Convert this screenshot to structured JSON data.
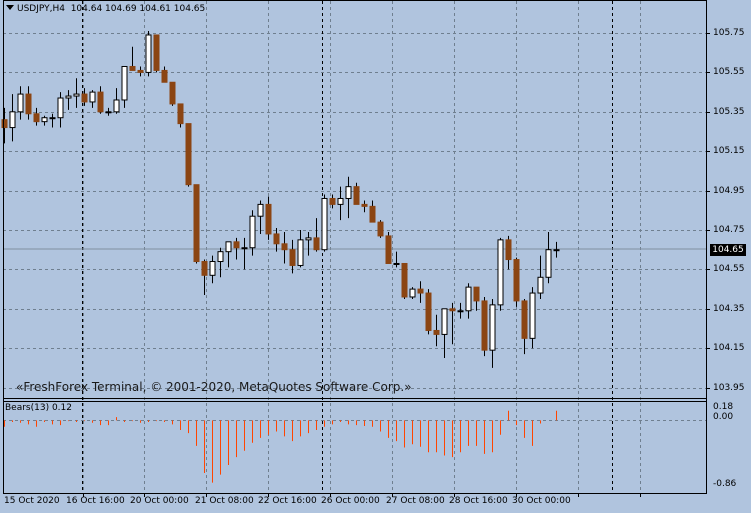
{
  "header": {
    "symbol_tf": "USDJPY,H4",
    "ohlc": "104.64 104.69 104.61 104.65"
  },
  "copyright": "«FreshForex Terminal, © 2001-2020, MetaQuotes Software Corp.»",
  "price_axis": {
    "ticks": [
      "105.75",
      "105.55",
      "105.35",
      "105.15",
      "104.95",
      "104.75",
      "104.55",
      "104.35",
      "104.15",
      "103.95"
    ],
    "current_price": "104.65"
  },
  "time_axis": {
    "ticks": [
      "15 Oct 2020",
      "16 Oct 16:00",
      "20 Oct 00:00",
      "21 Oct 08:00",
      "22 Oct 16:00",
      "26 Oct 00:00",
      "27 Oct 08:00",
      "28 Oct 16:00",
      "30 Oct 00:00"
    ]
  },
  "indicator": {
    "title": "Bears(13) 0.12",
    "ticks": [
      "0.18",
      "0.00",
      "-0.86"
    ]
  },
  "colors": {
    "background": "#b0c4de",
    "bull": "#ffffff",
    "bear": "#8b4513",
    "histogram": "#ff4500",
    "grid": "#6f7f8f"
  },
  "chart_data": {
    "type": "candlestick",
    "ylim": [
      103.91,
      105.82
    ],
    "candles": [
      {
        "o": 105.31,
        "h": 105.37,
        "l": 105.19,
        "c": 105.27
      },
      {
        "o": 105.27,
        "h": 105.44,
        "l": 105.2,
        "c": 105.35
      },
      {
        "o": 105.35,
        "h": 105.48,
        "l": 105.31,
        "c": 105.44
      },
      {
        "o": 105.44,
        "h": 105.48,
        "l": 105.31,
        "c": 105.34
      },
      {
        "o": 105.34,
        "h": 105.37,
        "l": 105.28,
        "c": 105.3
      },
      {
        "o": 105.3,
        "h": 105.33,
        "l": 105.28,
        "c": 105.32
      },
      {
        "o": 105.32,
        "h": 105.34,
        "l": 105.27,
        "c": 105.32
      },
      {
        "o": 105.32,
        "h": 105.45,
        "l": 105.27,
        "c": 105.42
      },
      {
        "o": 105.42,
        "h": 105.46,
        "l": 105.36,
        "c": 105.43
      },
      {
        "o": 105.43,
        "h": 105.52,
        "l": 105.37,
        "c": 105.44
      },
      {
        "o": 105.44,
        "h": 105.47,
        "l": 105.38,
        "c": 105.4
      },
      {
        "o": 105.4,
        "h": 105.46,
        "l": 105.37,
        "c": 105.45
      },
      {
        "o": 105.45,
        "h": 105.48,
        "l": 105.34,
        "c": 105.35
      },
      {
        "o": 105.35,
        "h": 105.37,
        "l": 105.33,
        "c": 105.35
      },
      {
        "o": 105.35,
        "h": 105.47,
        "l": 105.34,
        "c": 105.41
      },
      {
        "o": 105.41,
        "h": 105.57,
        "l": 105.37,
        "c": 105.58
      },
      {
        "o": 105.58,
        "h": 105.68,
        "l": 105.56,
        "c": 105.56
      },
      {
        "o": 105.56,
        "h": 105.58,
        "l": 105.53,
        "c": 105.55
      },
      {
        "o": 105.55,
        "h": 105.76,
        "l": 105.53,
        "c": 105.74
      },
      {
        "o": 105.74,
        "h": 105.69,
        "l": 105.55,
        "c": 105.56
      },
      {
        "o": 105.56,
        "h": 105.58,
        "l": 105.5,
        "c": 105.5
      },
      {
        "o": 105.5,
        "h": 105.5,
        "l": 105.38,
        "c": 105.39
      },
      {
        "o": 105.39,
        "h": 105.39,
        "l": 105.27,
        "c": 105.29
      },
      {
        "o": 105.29,
        "h": 105.29,
        "l": 104.97,
        "c": 104.98
      },
      {
        "o": 104.98,
        "h": 104.98,
        "l": 104.58,
        "c": 104.59
      },
      {
        "o": 104.59,
        "h": 104.6,
        "l": 104.42,
        "c": 104.52
      },
      {
        "o": 104.52,
        "h": 104.62,
        "l": 104.48,
        "c": 104.59
      },
      {
        "o": 104.59,
        "h": 104.66,
        "l": 104.51,
        "c": 104.64
      },
      {
        "o": 104.64,
        "h": 104.67,
        "l": 104.56,
        "c": 104.69
      },
      {
        "o": 104.69,
        "h": 104.71,
        "l": 104.6,
        "c": 104.66
      },
      {
        "o": 104.66,
        "h": 104.71,
        "l": 104.55,
        "c": 104.66
      },
      {
        "o": 104.66,
        "h": 104.85,
        "l": 104.62,
        "c": 104.82
      },
      {
        "o": 104.82,
        "h": 104.9,
        "l": 104.73,
        "c": 104.88
      },
      {
        "o": 104.88,
        "h": 104.92,
        "l": 104.7,
        "c": 104.73
      },
      {
        "o": 104.73,
        "h": 104.76,
        "l": 104.64,
        "c": 104.68
      },
      {
        "o": 104.68,
        "h": 104.74,
        "l": 104.58,
        "c": 104.65
      },
      {
        "o": 104.65,
        "h": 104.7,
        "l": 104.53,
        "c": 104.57
      },
      {
        "o": 104.57,
        "h": 104.75,
        "l": 104.56,
        "c": 104.7
      },
      {
        "o": 104.7,
        "h": 104.74,
        "l": 104.62,
        "c": 104.71
      },
      {
        "o": 104.71,
        "h": 104.81,
        "l": 104.64,
        "c": 104.65
      },
      {
        "o": 104.65,
        "h": 104.93,
        "l": 104.64,
        "c": 104.91
      },
      {
        "o": 104.91,
        "h": 104.93,
        "l": 104.86,
        "c": 104.88
      },
      {
        "o": 104.88,
        "h": 104.97,
        "l": 104.8,
        "c": 104.91
      },
      {
        "o": 104.91,
        "h": 105.02,
        "l": 104.81,
        "c": 104.97
      },
      {
        "o": 104.97,
        "h": 104.99,
        "l": 104.88,
        "c": 104.88
      },
      {
        "o": 104.88,
        "h": 104.9,
        "l": 104.84,
        "c": 104.87
      },
      {
        "o": 104.87,
        "h": 104.9,
        "l": 104.79,
        "c": 104.79
      },
      {
        "o": 104.79,
        "h": 104.8,
        "l": 104.71,
        "c": 104.72
      },
      {
        "o": 104.72,
        "h": 104.74,
        "l": 104.58,
        "c": 104.58
      },
      {
        "o": 104.58,
        "h": 104.64,
        "l": 104.56,
        "c": 104.58
      },
      {
        "o": 104.58,
        "h": 104.58,
        "l": 104.4,
        "c": 104.41
      },
      {
        "o": 104.41,
        "h": 104.46,
        "l": 104.4,
        "c": 104.45
      },
      {
        "o": 104.45,
        "h": 104.49,
        "l": 104.38,
        "c": 104.43
      },
      {
        "o": 104.43,
        "h": 104.45,
        "l": 104.22,
        "c": 104.24
      },
      {
        "o": 104.24,
        "h": 104.32,
        "l": 104.16,
        "c": 104.22
      },
      {
        "o": 104.22,
        "h": 104.35,
        "l": 104.1,
        "c": 104.35
      },
      {
        "o": 104.35,
        "h": 104.38,
        "l": 104.17,
        "c": 104.34
      },
      {
        "o": 104.34,
        "h": 104.38,
        "l": 104.3,
        "c": 104.34
      },
      {
        "o": 104.34,
        "h": 104.48,
        "l": 104.3,
        "c": 104.46
      },
      {
        "o": 104.46,
        "h": 104.46,
        "l": 104.34,
        "c": 104.39
      },
      {
        "o": 104.39,
        "h": 104.41,
        "l": 104.11,
        "c": 104.14
      },
      {
        "o": 104.14,
        "h": 104.4,
        "l": 104.05,
        "c": 104.37
      },
      {
        "o": 104.37,
        "h": 104.71,
        "l": 104.34,
        "c": 104.7
      },
      {
        "o": 104.7,
        "h": 104.72,
        "l": 104.55,
        "c": 104.6
      },
      {
        "o": 104.6,
        "h": 104.61,
        "l": 104.36,
        "c": 104.39
      },
      {
        "o": 104.39,
        "h": 104.4,
        "l": 104.12,
        "c": 104.2
      },
      {
        "o": 104.2,
        "h": 104.46,
        "l": 104.15,
        "c": 104.43
      },
      {
        "o": 104.43,
        "h": 104.62,
        "l": 104.4,
        "c": 104.51
      },
      {
        "o": 104.51,
        "h": 104.74,
        "l": 104.48,
        "c": 104.65
      },
      {
        "o": 104.65,
        "h": 104.69,
        "l": 104.61,
        "c": 104.65
      }
    ],
    "indicator": {
      "name": "Bears(13)",
      "ylim": [
        -0.86,
        0.18
      ],
      "values": [
        -0.08,
        -0.02,
        -0.03,
        -0.05,
        -0.08,
        -0.02,
        -0.05,
        -0.06,
        -0.01,
        -0.02,
        -0.01,
        -0.03,
        -0.06,
        -0.06,
        0.04,
        -0.02,
        -0.01,
        -0.03,
        -0.02,
        -0.01,
        -0.02,
        -0.05,
        -0.12,
        -0.16,
        -0.32,
        -0.66,
        -0.78,
        -0.68,
        -0.56,
        -0.46,
        -0.38,
        -0.28,
        -0.22,
        -0.18,
        -0.14,
        -0.2,
        -0.26,
        -0.2,
        -0.16,
        -0.12,
        -0.08,
        -0.05,
        -0.02,
        -0.05,
        -0.06,
        -0.07,
        -0.08,
        -0.14,
        -0.22,
        -0.26,
        -0.34,
        -0.3,
        -0.33,
        -0.4,
        -0.4,
        -0.44,
        -0.46,
        -0.4,
        -0.32,
        -0.32,
        -0.42,
        -0.4,
        -0.18,
        0.12,
        -0.06,
        -0.22,
        -0.32,
        -0.04,
        0.0,
        0.12
      ]
    }
  }
}
